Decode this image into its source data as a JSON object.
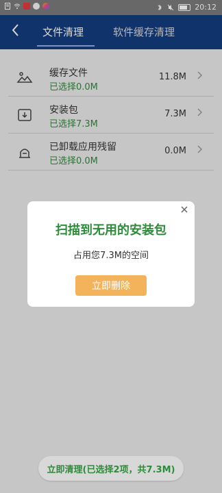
{
  "status": {
    "time": "20:12"
  },
  "header": {
    "tab1": "文件清理",
    "tab2": "软件缓存清理"
  },
  "list": {
    "items": [
      {
        "title": "缓存文件",
        "subtitle": "已选择0.0M",
        "size": "11.8M",
        "icon": "image-icon"
      },
      {
        "title": "安装包",
        "subtitle": "已选择7.3M",
        "size": "7.3M",
        "icon": "download-icon"
      },
      {
        "title": "已卸载应用残留",
        "subtitle": "已选择0.0M",
        "size": "0.0M",
        "icon": "residue-icon"
      }
    ]
  },
  "dialog": {
    "title": "扫描到无用的安装包",
    "subtitle": "占用您7.3M的空间",
    "button": "立即删除"
  },
  "bottom": {
    "button": "立即清理(已选择2项，共7.3M)"
  }
}
